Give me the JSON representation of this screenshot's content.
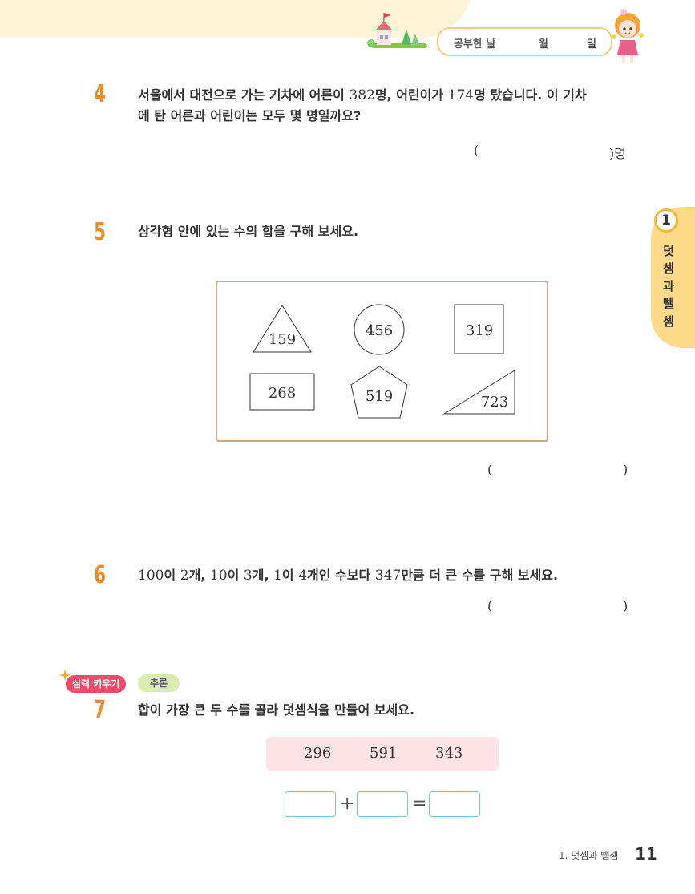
{
  "header": {
    "study_day_label": "공부한 날",
    "month_label": "월",
    "day_label": "일"
  },
  "side_tab": {
    "unit_number": "1",
    "unit_title_chars": [
      "덧",
      "셈",
      "과",
      "뺄",
      "셈"
    ]
  },
  "q4": {
    "number": "4",
    "line1_a": "서울에서 대전으로 가는 기차에 어른이 ",
    "line1_n1": "382",
    "line1_b": "명, 어린이가 ",
    "line1_n2": "174",
    "line1_c": "명 탔습니다. 이 기차",
    "line2": "에 탄 어른과 어린이는 모두 몇 명일까요?",
    "answer_open": "(",
    "answer_close": ")명"
  },
  "q5": {
    "number": "5",
    "text": "삼각형 안에 있는 수의 합을 구해 보세요.",
    "shapes": {
      "triangle": "159",
      "circle": "456",
      "square": "319",
      "rectangle": "268",
      "pentagon": "519",
      "right_triangle": "723"
    },
    "answer_open": "(",
    "answer_close": ")"
  },
  "q6": {
    "number": "6",
    "n1": "100",
    "t1": "이 ",
    "n2": "2",
    "t2": "개, ",
    "n3": "10",
    "t3": "이 ",
    "n4": "3",
    "t4": "개, ",
    "n5": "1",
    "t5": "이 ",
    "n6": "4",
    "t6": "개인 수보다 ",
    "n7": "347",
    "t7": "만큼 더 큰 수를 구해 보세요.",
    "answer_open": "(",
    "answer_close": ")"
  },
  "q7": {
    "badge": "실력 키우기",
    "tag": "추론",
    "number": "7",
    "text": "합이 가장 큰 두 수를 골라 덧셈식을 만들어 보세요.",
    "choices": [
      "296",
      "591",
      "343"
    ],
    "plus": "+",
    "equals": "="
  },
  "footer": {
    "chapter": "1. 덧셈과 뺄셈",
    "page": "11"
  },
  "colors": {
    "question_number": "#f08a24",
    "side_tab": "#fdd98a",
    "badge": "#ef4a6a",
    "tag": "#d9ecb1",
    "choice_box": "#fde2e6",
    "answer_box_border": "#7bc6cc"
  }
}
